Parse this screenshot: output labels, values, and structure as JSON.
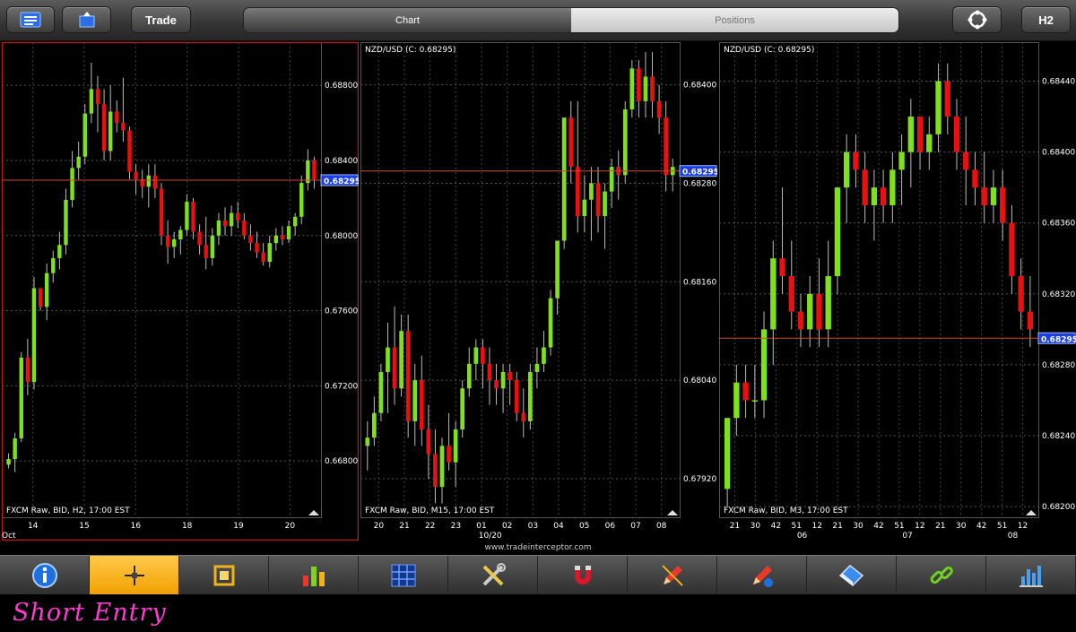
{
  "topbar": {
    "trade_label": "Trade",
    "tabs": [
      "Chart",
      "Positions"
    ],
    "timeframe_label": "H2"
  },
  "colors": {
    "up": "#7fe01c",
    "down": "#e81010",
    "line": "#d04a3a",
    "badge": "#1b3fe0"
  },
  "charts": [
    {
      "title": "",
      "footer": "FXCM Raw, BID, H2, 17:00 EST",
      "current_price": "0.68295",
      "y_ticks": [
        "0.68800",
        "0.68400",
        "0.68000",
        "0.67600",
        "0.67200",
        "0.66800"
      ],
      "y_min": 0.665,
      "y_max": 0.6903,
      "x_labels": [
        "14",
        "15",
        "16",
        "18",
        "19",
        "20"
      ],
      "x_sub_label": "Oct",
      "candles": [
        [
          0.6678,
          0.6684,
          0.6676,
          0.6681
        ],
        [
          0.6681,
          0.6695,
          0.6674,
          0.6692
        ],
        [
          0.6692,
          0.6738,
          0.669,
          0.6735
        ],
        [
          0.6735,
          0.6745,
          0.6715,
          0.6722
        ],
        [
          0.6722,
          0.6778,
          0.6718,
          0.6772
        ],
        [
          0.6772,
          0.6768,
          0.676,
          0.6762
        ],
        [
          0.6762,
          0.6785,
          0.6755,
          0.678
        ],
        [
          0.678,
          0.6792,
          0.6775,
          0.6788
        ],
        [
          0.6788,
          0.6802,
          0.6782,
          0.6795
        ],
        [
          0.6795,
          0.6825,
          0.679,
          0.6819
        ],
        [
          0.6819,
          0.6845,
          0.6815,
          0.6836
        ],
        [
          0.6836,
          0.685,
          0.683,
          0.6842
        ],
        [
          0.6842,
          0.687,
          0.6838,
          0.6865
        ],
        [
          0.6865,
          0.6892,
          0.686,
          0.6878
        ],
        [
          0.6878,
          0.6885,
          0.6855,
          0.687
        ],
        [
          0.687,
          0.6878,
          0.684,
          0.6845
        ],
        [
          0.6845,
          0.688,
          0.684,
          0.6866
        ],
        [
          0.6866,
          0.6872,
          0.6855,
          0.686
        ],
        [
          0.686,
          0.6884,
          0.685,
          0.6856
        ],
        [
          0.6856,
          0.6858,
          0.683,
          0.6834
        ],
        [
          0.6834,
          0.6838,
          0.6822,
          0.683
        ],
        [
          0.683,
          0.6835,
          0.682,
          0.6826
        ],
        [
          0.6826,
          0.6838,
          0.6815,
          0.6832
        ],
        [
          0.6832,
          0.6838,
          0.682,
          0.6825
        ],
        [
          0.6825,
          0.6828,
          0.6795,
          0.68
        ],
        [
          0.68,
          0.6808,
          0.6785,
          0.6794
        ],
        [
          0.6794,
          0.6802,
          0.6788,
          0.6798
        ],
        [
          0.6798,
          0.6805,
          0.679,
          0.6803
        ],
        [
          0.6803,
          0.6822,
          0.68,
          0.6818
        ],
        [
          0.6818,
          0.682,
          0.6798,
          0.6802
        ],
        [
          0.6802,
          0.6806,
          0.679,
          0.6795
        ],
        [
          0.6795,
          0.681,
          0.6782,
          0.6788
        ],
        [
          0.6788,
          0.6804,
          0.6784,
          0.68
        ],
        [
          0.68,
          0.6812,
          0.6795,
          0.6808
        ],
        [
          0.6808,
          0.6815,
          0.68,
          0.6805
        ],
        [
          0.6805,
          0.6816,
          0.68,
          0.6812
        ],
        [
          0.6812,
          0.6818,
          0.6804,
          0.6808
        ],
        [
          0.6808,
          0.6812,
          0.6798,
          0.68
        ],
        [
          0.68,
          0.6806,
          0.6792,
          0.6796
        ],
        [
          0.6796,
          0.6802,
          0.6788,
          0.6791
        ],
        [
          0.6791,
          0.6796,
          0.6784,
          0.6786
        ],
        [
          0.6786,
          0.68,
          0.6783,
          0.6796
        ],
        [
          0.6796,
          0.6804,
          0.6792,
          0.68
        ],
        [
          0.68,
          0.6805,
          0.6795,
          0.6798
        ],
        [
          0.6798,
          0.6808,
          0.6796,
          0.6805
        ],
        [
          0.6805,
          0.6812,
          0.68,
          0.681
        ],
        [
          0.681,
          0.6832,
          0.6806,
          0.6828
        ],
        [
          0.6828,
          0.6846,
          0.6824,
          0.684
        ],
        [
          0.684,
          0.6842,
          0.6825,
          0.683
        ]
      ]
    },
    {
      "title": "NZD/USD (C: 0.68295)",
      "footer": "FXCM Raw, BID, M15, 17:00 EST",
      "current_price": "0.68295",
      "y_ticks": [
        "0.68400",
        "0.68280",
        "0.68160",
        "0.68040",
        "0.67920"
      ],
      "y_min": 0.67873,
      "y_max": 0.68452,
      "x_labels": [
        "20",
        "21",
        "22",
        "23",
        "01",
        "02",
        "03",
        "04",
        "05",
        "06",
        "07",
        "08"
      ],
      "x_sub_label": "10/20",
      "candles": [
        [
          0.6796,
          0.6799,
          0.6793,
          0.6797
        ],
        [
          0.6797,
          0.6802,
          0.6796,
          0.68
        ],
        [
          0.68,
          0.6806,
          0.6799,
          0.6805
        ],
        [
          0.6805,
          0.6811,
          0.68,
          0.6808
        ],
        [
          0.6808,
          0.6813,
          0.6801,
          0.6803
        ],
        [
          0.6803,
          0.6812,
          0.6802,
          0.681
        ],
        [
          0.681,
          0.6812,
          0.6797,
          0.6799
        ],
        [
          0.6799,
          0.6806,
          0.6796,
          0.6804
        ],
        [
          0.6804,
          0.6807,
          0.6796,
          0.6798
        ],
        [
          0.6798,
          0.6801,
          0.6792,
          0.6795
        ],
        [
          0.6795,
          0.6798,
          0.6789,
          0.6791
        ],
        [
          0.6791,
          0.6797,
          0.6789,
          0.6796
        ],
        [
          0.6796,
          0.68,
          0.6793,
          0.6794
        ],
        [
          0.6794,
          0.6799,
          0.6791,
          0.6798
        ],
        [
          0.6798,
          0.6804,
          0.6797,
          0.6803
        ],
        [
          0.6803,
          0.6808,
          0.6802,
          0.6806
        ],
        [
          0.6806,
          0.6809,
          0.6804,
          0.6808
        ],
        [
          0.6808,
          0.6809,
          0.6803,
          0.6806
        ],
        [
          0.6806,
          0.6808,
          0.6801,
          0.6804
        ],
        [
          0.6804,
          0.6806,
          0.6801,
          0.6803
        ],
        [
          0.6803,
          0.6806,
          0.68,
          0.6805
        ],
        [
          0.6805,
          0.6806,
          0.6801,
          0.6804
        ],
        [
          0.6804,
          0.6805,
          0.6799,
          0.68
        ],
        [
          0.68,
          0.6803,
          0.6797,
          0.6799
        ],
        [
          0.6799,
          0.6806,
          0.6798,
          0.6805
        ],
        [
          0.6805,
          0.6808,
          0.6803,
          0.6806
        ],
        [
          0.6806,
          0.681,
          0.6805,
          0.6808
        ],
        [
          0.6808,
          0.6815,
          0.6807,
          0.6814
        ],
        [
          0.6814,
          0.6821,
          0.6812,
          0.6821
        ],
        [
          0.6821,
          0.6836,
          0.682,
          0.6836
        ],
        [
          0.6836,
          0.6838,
          0.6828,
          0.683
        ],
        [
          0.683,
          0.6838,
          0.6822,
          0.6824
        ],
        [
          0.6824,
          0.6829,
          0.6822,
          0.6826
        ],
        [
          0.6826,
          0.683,
          0.6821,
          0.6828
        ],
        [
          0.6828,
          0.683,
          0.6822,
          0.6824
        ],
        [
          0.6824,
          0.6828,
          0.682,
          0.6827
        ],
        [
          0.6827,
          0.6831,
          0.6825,
          0.683
        ],
        [
          0.683,
          0.6832,
          0.6826,
          0.6829
        ],
        [
          0.6829,
          0.6838,
          0.6828,
          0.6837
        ],
        [
          0.6837,
          0.6843,
          0.6836,
          0.6842
        ],
        [
          0.6842,
          0.6843,
          0.6836,
          0.6838
        ],
        [
          0.6838,
          0.6844,
          0.6836,
          0.6841
        ],
        [
          0.6841,
          0.6844,
          0.6836,
          0.6838
        ],
        [
          0.6838,
          0.684,
          0.6834,
          0.6836
        ],
        [
          0.6836,
          0.6838,
          0.6827,
          0.6829
        ],
        [
          0.6829,
          0.6831,
          0.6827,
          0.683
        ]
      ]
    },
    {
      "title": "NZD/USD (C: 0.68295)",
      "footer": "FXCM Raw, BID, M3, 17:00 EST",
      "current_price": "0.68295",
      "y_ticks": [
        "0.68440",
        "0.68400",
        "0.68360",
        "0.68320",
        "0.68280",
        "0.68240",
        "0.68200"
      ],
      "y_min": 0.68194,
      "y_max": 0.68462,
      "x_labels": [
        "21",
        "30",
        "42",
        "51",
        "12",
        "21",
        "30",
        "42",
        "51",
        "12",
        "21",
        "30",
        "42",
        "51",
        "12"
      ],
      "x_sub_labels": [
        "06",
        "07",
        "08"
      ],
      "candles": [
        [
          0.6821,
          0.6825,
          0.682,
          0.6825
        ],
        [
          0.6825,
          0.6828,
          0.6824,
          0.6827
        ],
        [
          0.6827,
          0.6828,
          0.6825,
          0.6826
        ],
        [
          0.6826,
          0.6828,
          0.6825,
          0.6826
        ],
        [
          0.6826,
          0.6831,
          0.6825,
          0.683
        ],
        [
          0.683,
          0.6835,
          0.6828,
          0.6834
        ],
        [
          0.6834,
          0.6838,
          0.6832,
          0.6833
        ],
        [
          0.6833,
          0.6835,
          0.683,
          0.6831
        ],
        [
          0.6831,
          0.6832,
          0.6829,
          0.683
        ],
        [
          0.683,
          0.6833,
          0.6829,
          0.6832
        ],
        [
          0.6832,
          0.6834,
          0.6829,
          0.683
        ],
        [
          0.683,
          0.6835,
          0.6829,
          0.6833
        ],
        [
          0.6833,
          0.6838,
          0.6832,
          0.6838
        ],
        [
          0.6838,
          0.6841,
          0.6836,
          0.684
        ],
        [
          0.684,
          0.6841,
          0.6838,
          0.6839
        ],
        [
          0.6839,
          0.684,
          0.6836,
          0.6837
        ],
        [
          0.6837,
          0.6839,
          0.6835,
          0.6838
        ],
        [
          0.6838,
          0.6839,
          0.6836,
          0.6837
        ],
        [
          0.6837,
          0.684,
          0.6836,
          0.6839
        ],
        [
          0.6839,
          0.6841,
          0.6837,
          0.684
        ],
        [
          0.684,
          0.6843,
          0.6838,
          0.6842
        ],
        [
          0.6842,
          0.6842,
          0.6839,
          0.684
        ],
        [
          0.684,
          0.6842,
          0.6839,
          0.6841
        ],
        [
          0.6841,
          0.6845,
          0.684,
          0.6844
        ],
        [
          0.6844,
          0.6845,
          0.6841,
          0.6842
        ],
        [
          0.6842,
          0.6843,
          0.6839,
          0.684
        ],
        [
          0.684,
          0.6842,
          0.6837,
          0.6839
        ],
        [
          0.6839,
          0.684,
          0.6837,
          0.6838
        ],
        [
          0.6838,
          0.684,
          0.6836,
          0.6837
        ],
        [
          0.6837,
          0.6839,
          0.6836,
          0.6838
        ],
        [
          0.6838,
          0.6839,
          0.6835,
          0.6836
        ],
        [
          0.6836,
          0.6837,
          0.6832,
          0.6833
        ],
        [
          0.6833,
          0.6834,
          0.683,
          0.6831
        ],
        [
          0.6831,
          0.6833,
          0.6829,
          0.683
        ]
      ]
    }
  ],
  "url": "www.tradeinterceptor.com",
  "toolbar": {
    "tools": [
      "info-icon",
      "crosshair-icon",
      "crop-icon",
      "indicators-icon",
      "grid-icon",
      "settings-tools-icon",
      "magnet-icon",
      "draw-icon",
      "draw-tools-icon",
      "eraser-icon",
      "link-icon",
      "chart-type-icon"
    ],
    "active_index": 1
  },
  "caption": "Short Entry"
}
